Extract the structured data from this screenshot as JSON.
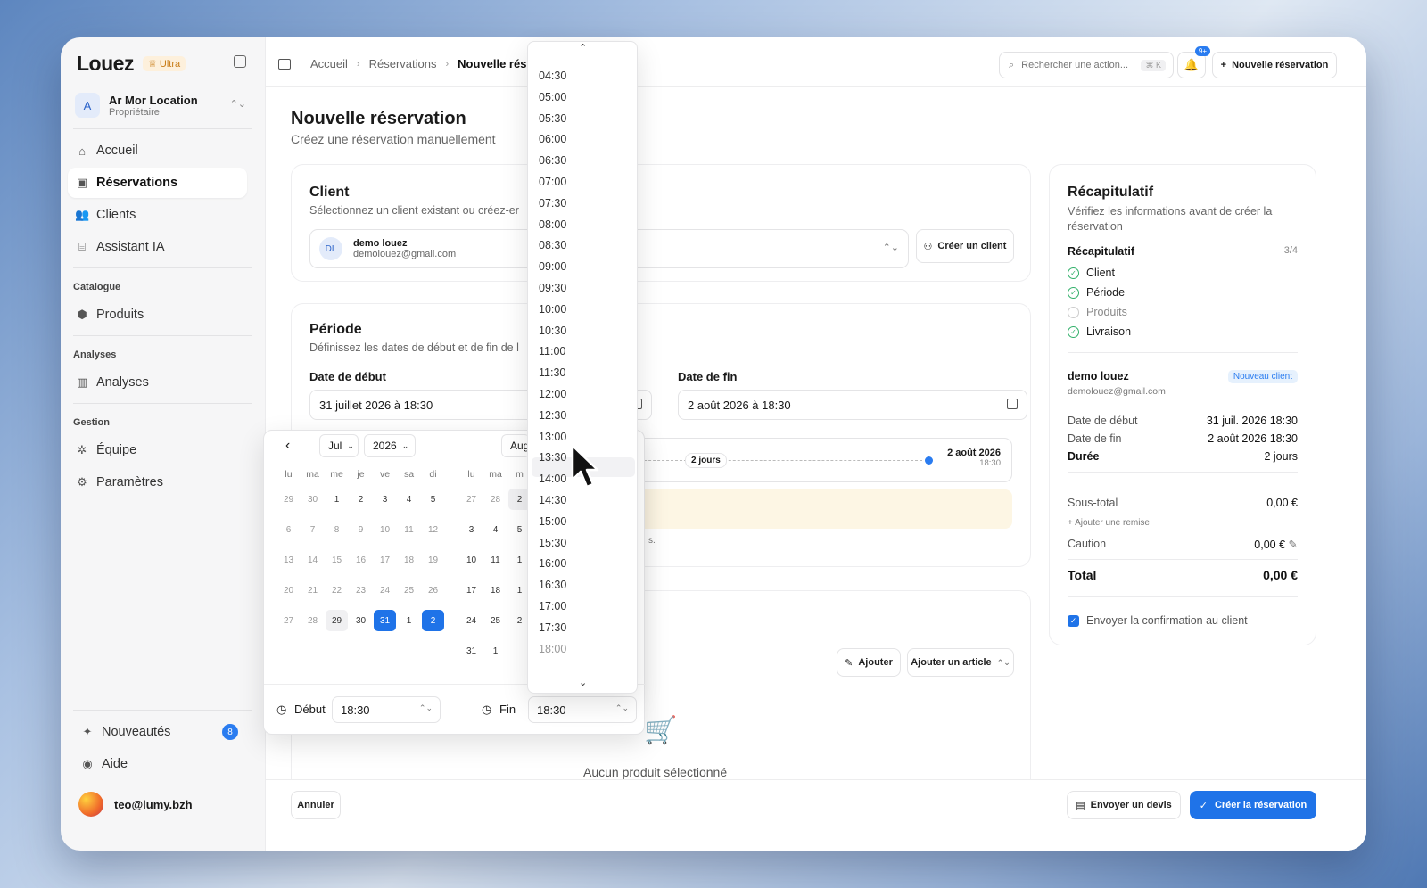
{
  "app": {
    "name": "Louez",
    "plan": "Ultra"
  },
  "org": {
    "initial": "A",
    "name": "Ar Mor Location",
    "role": "Propriétaire"
  },
  "sidebar": {
    "main": [
      "Accueil",
      "Réservations",
      "Clients",
      "Assistant IA"
    ],
    "catalogue_title": "Catalogue",
    "catalogue": [
      "Produits"
    ],
    "analyses_title": "Analyses",
    "analyses": [
      "Analyses"
    ],
    "gestion_title": "Gestion",
    "gestion": [
      "Équipe",
      "Paramètres"
    ],
    "news": "Nouveautés",
    "news_count": "8",
    "help": "Aide",
    "user_email": "teo@lumy.bzh"
  },
  "topbar": {
    "crumbs": [
      "Accueil",
      "Réservations",
      "Nouvelle rése"
    ],
    "search_placeholder": "Rechercher une action...",
    "search_kbd": "⌘ K",
    "bell_badge": "9+",
    "new_button": "Nouvelle réservation"
  },
  "page": {
    "title": "Nouvelle réservation",
    "subtitle": "Créez une réservation manuellement"
  },
  "client": {
    "title": "Client",
    "subtitle": "Sélectionnez un client existant ou créez-er",
    "initials": "DL",
    "name": "demo louez",
    "email": "demolouez@gmail.com",
    "create_button": "Créer un client"
  },
  "period": {
    "title": "Période",
    "subtitle": "Définissez les dates de début et de fin de l",
    "start_label": "Date de début",
    "start_value": "31 juillet 2026 à 18:30",
    "end_label": "Date de fin",
    "end_value": "2 août 2026 à 18:30",
    "duration": "2 jours",
    "end_date": "2 août 2026",
    "end_time": "18:30",
    "note_fragment": "s."
  },
  "products": {
    "add_button": "Ajouter",
    "add_article": "Ajouter un article",
    "empty": "Aucun produit sélectionné"
  },
  "datepicker": {
    "month": "Jul",
    "year": "2026",
    "next_month": "Aug",
    "weekdays": [
      "lu",
      "ma",
      "me",
      "je",
      "ve",
      "sa",
      "di"
    ],
    "weekdays_partial": [
      "lu",
      "ma",
      "m"
    ],
    "jul_rows": [
      [
        "29",
        "30",
        "1",
        "2",
        "3",
        "4",
        "5"
      ],
      [
        "6",
        "7",
        "8",
        "9",
        "10",
        "11",
        "12"
      ],
      [
        "13",
        "14",
        "15",
        "16",
        "17",
        "18",
        "19"
      ],
      [
        "20",
        "21",
        "22",
        "23",
        "24",
        "25",
        "26"
      ],
      [
        "27",
        "28",
        "29",
        "30",
        "31",
        "1",
        "2"
      ]
    ],
    "aug_rows": [
      [
        "27",
        "28",
        "2"
      ],
      [
        "3",
        "4",
        "5"
      ],
      [
        "10",
        "11",
        "1"
      ],
      [
        "17",
        "18",
        "1"
      ],
      [
        "24",
        "25",
        "2"
      ],
      [
        "31",
        "1",
        ""
      ]
    ],
    "start_time_label": "Début",
    "start_time": "18:30",
    "end_time_label": "Fin",
    "end_time": "18:30"
  },
  "time_options": [
    "04:30",
    "05:00",
    "05:30",
    "06:00",
    "06:30",
    "07:00",
    "07:30",
    "08:00",
    "08:30",
    "09:00",
    "09:30",
    "10:00",
    "10:30",
    "11:00",
    "11:30",
    "12:00",
    "12:30",
    "13:00",
    "13:30",
    "14:00",
    "14:30",
    "15:00",
    "15:30",
    "16:00",
    "16:30",
    "17:00",
    "17:30",
    "18:00"
  ],
  "time_hover": "13:30",
  "summary": {
    "title": "Récapitulatif",
    "subtitle": "Vérifiez les informations avant de créer la réservation",
    "steps_title": "Récapitulatif",
    "steps_count": "3/4",
    "steps": [
      {
        "label": "Client",
        "done": true
      },
      {
        "label": "Période",
        "done": true
      },
      {
        "label": "Produits",
        "done": false
      },
      {
        "label": "Livraison",
        "done": true
      }
    ],
    "client_name": "demo louez",
    "client_email": "demolouez@gmail.com",
    "client_badge": "Nouveau client",
    "start_label": "Date de début",
    "start_value": "31 juil. 2026 18:30",
    "end_label": "Date de fin",
    "end_value": "2 août 2026 18:30",
    "duration_label": "Durée",
    "duration_value": "2 jours",
    "subtotal_label": "Sous-total",
    "subtotal_value": "0,00 €",
    "discount_link": "+ Ajouter une remise",
    "deposit_label": "Caution",
    "deposit_value": "0,00 €",
    "total_label": "Total",
    "total_value": "0,00 €",
    "confirm_label": "Envoyer la confirmation au client"
  },
  "footer": {
    "cancel": "Annuler",
    "quote": "Envoyer un devis",
    "create": "Créer la réservation"
  },
  "colors": {
    "accent": "#1f73e8",
    "success": "#32b06a"
  }
}
